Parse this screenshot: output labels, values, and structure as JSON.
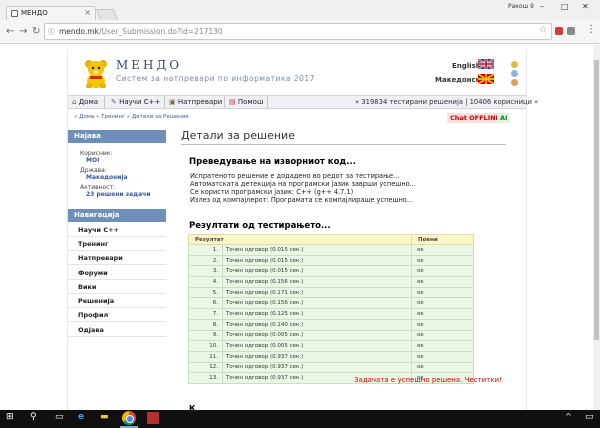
{
  "browser": {
    "tab_title": "МЕНДО",
    "user_label": "Ракош 9",
    "url_host": "mendo.mk",
    "url_path": "/User_Submission.do?id=217130"
  },
  "site": {
    "title": "МЕНДО",
    "subtitle": "Систем за натпревари по информатика 2017",
    "lang_english": "English",
    "lang_macedonian": "Македонски"
  },
  "topnav": {
    "items": [
      {
        "label": "Дома",
        "icon": "home-icon"
      },
      {
        "label": "Научи C++",
        "icon": "book-icon"
      },
      {
        "label": "Натпревари",
        "icon": "trophy-icon"
      },
      {
        "label": "Помош",
        "icon": "help-icon"
      }
    ],
    "stats": "» 319834 тестирани решенија | 10406 корисници «"
  },
  "breadcrumb": "» Дома » Тренинг » Детали за Решение",
  "badges": {
    "chat": "Chat OFFLINE",
    "ai": "AI"
  },
  "sidebar": {
    "login_header": "Најава",
    "user_label": "Корисник:",
    "user_value": "MOI",
    "country_label": "Држава:",
    "country_value": "Македонија",
    "activity_label": "Активност:",
    "activity_value": "23 решени задачи",
    "nav_header": "Навигација",
    "nav_items": [
      "Научи C++",
      "Тренинг",
      "Натпревари",
      "Форуми",
      "Вики",
      "Решенија",
      "Профил",
      "Одјава"
    ]
  },
  "main": {
    "title": "Детали за решение",
    "compile_heading": "Преведување на изворниот код...",
    "compile_lines": [
      "Испратеното решение е додадено во редот за тестирање...",
      "Автоматската детекција на програмски јазик заврши успешно...",
      "Се користи програмски јазик: C++ (g++ 4.7.1)",
      "Излез од компајлерот: Програмата се компајлираше успешно..."
    ],
    "results_heading": "Резултати од тестирањето...",
    "table": {
      "header_result": "Резултат",
      "header_points": "Поени",
      "rows": [
        {
          "n": "1.",
          "result": "Точен одговор (0.015 сек.)",
          "points": "ок"
        },
        {
          "n": "2.",
          "result": "Точен одговор (0.015 сек.)",
          "points": "ок"
        },
        {
          "n": "3.",
          "result": "Точен одговор (0.015 сек.)",
          "points": "ок"
        },
        {
          "n": "4.",
          "result": "Точен одговор (0.156 сек.)",
          "points": "ок"
        },
        {
          "n": "5.",
          "result": "Точен одговор (0.171 сек.)",
          "points": "ок"
        },
        {
          "n": "6.",
          "result": "Точен одговор (0.156 сек.)",
          "points": "ок"
        },
        {
          "n": "7.",
          "result": "Точен одговор (0.125 сек.)",
          "points": "ок"
        },
        {
          "n": "8.",
          "result": "Точен одговор (0.140 сек.)",
          "points": "ок"
        },
        {
          "n": "9.",
          "result": "Точен одговор (0.005 сек.)",
          "points": "ок"
        },
        {
          "n": "10.",
          "result": "Точен одговор (0.005 сек.)",
          "points": "ок"
        },
        {
          "n": "11.",
          "result": "Точен одговор (0.937 сек.)",
          "points": "ок"
        },
        {
          "n": "12.",
          "result": "Точен одговор (0.937 сек.)",
          "points": "ок"
        },
        {
          "n": "13.",
          "result": "Точен одговор (0.937 сек.)",
          "points": "ок"
        }
      ]
    },
    "success_message": "Задачата е успешно решена. Честитки!",
    "next_heading_stub": "К"
  },
  "colors": {
    "sidebar_header": "#6e8fb8",
    "table_header": "#fbf6c8",
    "table_row": "#e9f7e4",
    "success": "#e00000",
    "link": "#3b5998"
  }
}
